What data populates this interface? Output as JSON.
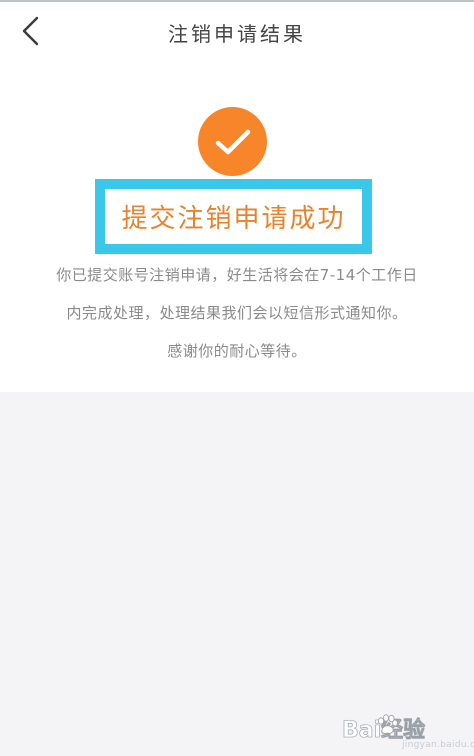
{
  "header": {
    "title": "注销申请结果",
    "back_icon": "chevron-left-icon"
  },
  "result": {
    "status_icon": "checkmark-circle-icon",
    "title": "提交注销申请成功",
    "description_lines": [
      "你已提交账号注销申请，好生活将会在7-14个工作日",
      "内完成处理，处理结果我们会以短信形式通知你。",
      "感谢你的耐心等待。"
    ]
  },
  "watermark": {
    "text": "Bai经验",
    "sub": "jingyan.baidu.com"
  },
  "colors": {
    "accent": "#f7862b",
    "highlight": "#39c7ea",
    "title_text": "#e8822c",
    "body_text": "#8a8a8a",
    "page_background": "#f4f4f6"
  }
}
